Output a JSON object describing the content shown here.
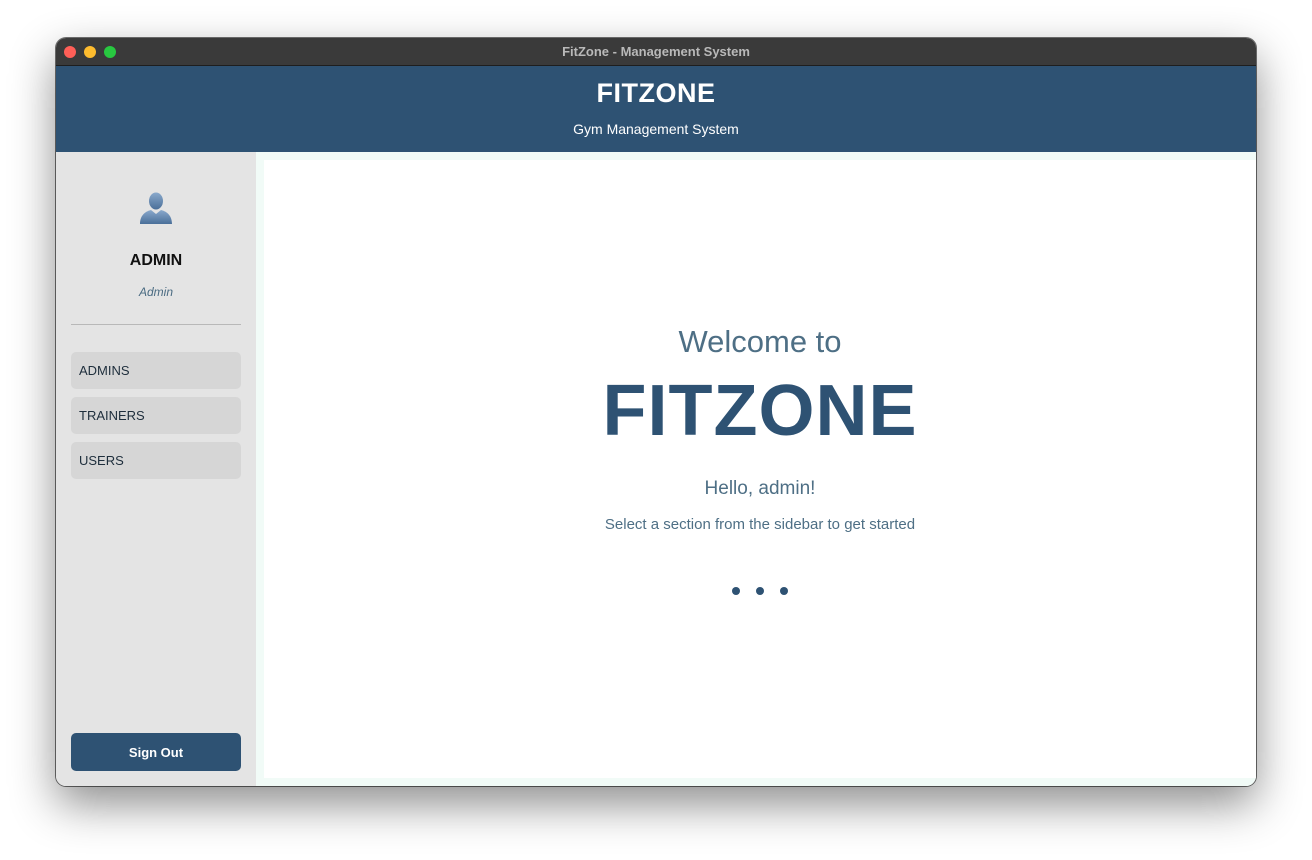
{
  "window": {
    "title": "FitZone - Management System"
  },
  "header": {
    "brand": "FITZONE",
    "tagline": "Gym Management System"
  },
  "sidebar": {
    "avatar_icon": "user-silhouette-icon",
    "user_name": "ADMIN",
    "user_role": "Admin",
    "items": [
      {
        "label": "ADMINS"
      },
      {
        "label": "TRAINERS"
      },
      {
        "label": "USERS"
      }
    ],
    "sign_out_label": "Sign Out"
  },
  "main": {
    "welcome": "Welcome to",
    "hero": "FITZONE",
    "greeting": "Hello, admin!",
    "hint": "Select a section from the sidebar to get started"
  },
  "colors": {
    "primary": "#2e5273",
    "sidebar_bg": "#e4e4e4",
    "nav_item_bg": "#d6d6d6",
    "muted_text": "#4e6f85",
    "titlebar": "#3a3a3a"
  }
}
